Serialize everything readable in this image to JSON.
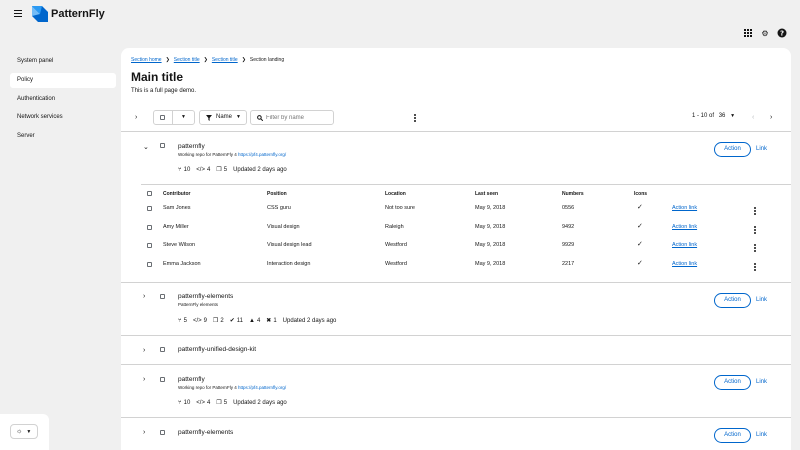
{
  "header": {
    "brand": "PatternFly",
    "icons": [
      "apps-grid-icon",
      "gear-icon",
      "help-icon"
    ],
    "colors": {
      "logo_dark": "#06c",
      "logo_light": "#73bcf7"
    }
  },
  "sidebar": {
    "items": [
      {
        "label": "System panel"
      },
      {
        "label": "Policy",
        "active": true
      },
      {
        "label": "Authentication"
      },
      {
        "label": "Network services"
      },
      {
        "label": "Server"
      }
    ],
    "theme_icon": "sun-icon"
  },
  "main": {
    "breadcrumb": [
      "Section home",
      "Section title",
      "Section title",
      "Section landing"
    ],
    "title": "Main title",
    "description": "This is a full page demo.",
    "toolbar": {
      "filter_label": "Name",
      "search_placeholder": "Filter by name",
      "pagination_range": "1 - 10",
      "pagination_of": "of",
      "pagination_total": "36"
    },
    "rows": [
      {
        "title": "patternfly",
        "desc_prefix": "Working repo for PatternFly 4 ",
        "desc_link": "https://pf4.patternfly.org/",
        "stats": {
          "branches": "10",
          "code": "4",
          "copies": "5",
          "updated": "Updated 2 days ago"
        },
        "action": "Action",
        "link": "Link",
        "expanded": true
      },
      {
        "title": "patternfly-elements",
        "desc": "PatternFly elements",
        "stats": {
          "branches": "5",
          "code": "9",
          "copies": "2",
          "checks": "11",
          "warnings": "4",
          "errors": "1",
          "updated": "Updated 2 days ago"
        },
        "action": "Action",
        "link": "Link"
      },
      {
        "title": "patternfly-unified-design-kit"
      },
      {
        "title": "patternfly",
        "desc_prefix": "Working repo for PatternFly 4 ",
        "desc_link": "https://pf4.patternfly.org/",
        "stats": {
          "branches": "10",
          "code": "4",
          "copies": "5",
          "updated": "Updated 2 days ago"
        },
        "action": "Action",
        "link": "Link"
      },
      {
        "title": "patternfly-elements",
        "action": "Action",
        "link": "Link"
      }
    ],
    "nested_table": {
      "headers": [
        "Contributor",
        "Position",
        "Location",
        "Last seen",
        "Numbers",
        "Icons"
      ],
      "rows": [
        {
          "contributor": "Sam Jones",
          "position": "CSS guru",
          "location": "Not too sure",
          "last_seen": "May 9, 2018",
          "numbers": "0556",
          "action": "Action link"
        },
        {
          "contributor": "Amy Miller",
          "position": "Visual design",
          "location": "Raleigh",
          "last_seen": "May 9, 2018",
          "numbers": "9492",
          "action": "Action link"
        },
        {
          "contributor": "Steve Wilson",
          "position": "Visual design lead",
          "location": "Westford",
          "last_seen": "May 9, 2018",
          "numbers": "9929",
          "action": "Action link"
        },
        {
          "contributor": "Emma Jackson",
          "position": "Interaction design",
          "location": "Westford",
          "last_seen": "May 9, 2018",
          "numbers": "2217",
          "action": "Action link"
        }
      ]
    }
  }
}
